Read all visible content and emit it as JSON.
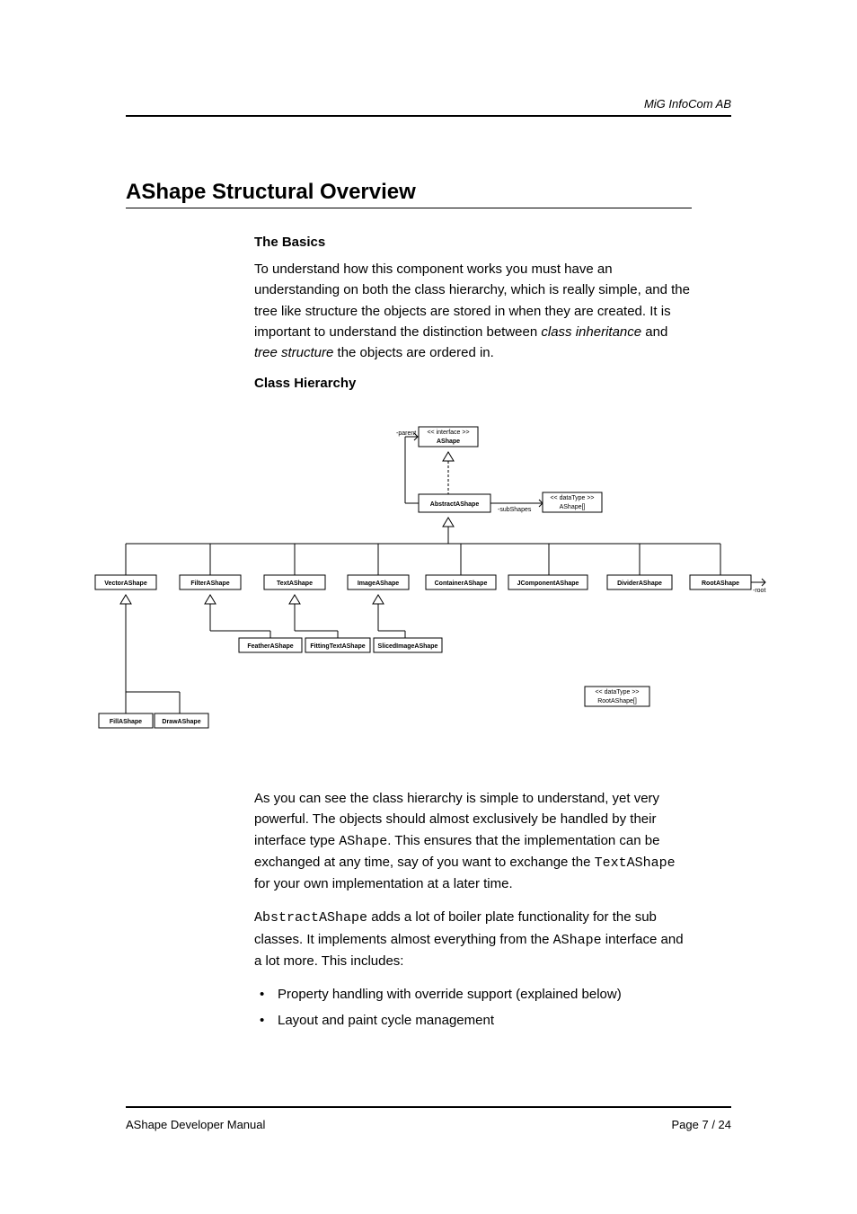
{
  "header": {
    "company": "MiG InfoCom AB"
  },
  "title": "AShape Structural Overview",
  "section1": {
    "heading": "The Basics",
    "p1_a": "To understand how this component works you must have an understanding on both the class hierarchy, which is really simple, and the tree like structure the objects are stored in when they are created. It is important to understand the distinction between ",
    "p1_i1": "class inheritance",
    "p1_b": " and ",
    "p1_i2": "tree structure",
    "p1_c": " the objects are ordered in."
  },
  "section2": {
    "heading": "Class Hierarchy"
  },
  "diagram": {
    "interface_stereo": "<< interface >>",
    "ashape": "AShape",
    "parent_lbl": "-parent",
    "abstract": "AbstractAShape",
    "subshapes_lbl": "-subShapes",
    "datatype_stereo": "<< dataType >>",
    "ashape_arr": "AShape[]",
    "leaves": {
      "vector": "VectorAShape",
      "filter": "FilterAShape",
      "text": "TextAShape",
      "image": "ImageAShape",
      "container": "ContainerAShape",
      "jcomponent": "JComponentAShape",
      "divider": "DividerAShape",
      "root": "RootAShape"
    },
    "sub2": {
      "feather": "FeatherAShape",
      "fittingtext": "FittingTextAShape",
      "slicedimage": "SlicedImageAShape",
      "fill": "FillAShape",
      "draw": "DrawAShape"
    },
    "rootarr_stereo": "<< dataType >>",
    "rootarr": "RootAShape[]",
    "root_lbl": "-root"
  },
  "section3": {
    "p1_a": "As you can see the class hierarchy is simple to understand, yet very powerful. The objects should almost exclusively be handled by their interface type ",
    "p1_m1": "AShape",
    "p1_b": ". This ensures that the implementation can be exchanged at any time, say of you want to exchange the ",
    "p1_m2": "TextAShape",
    "p1_c": " for your own implementation at a later time.",
    "p2_m1": "AbstractAShape",
    "p2_a": " adds a lot of boiler plate functionality for the sub classes. It implements almost everything from the ",
    "p2_m2": "AShape",
    "p2_b": " interface and a lot more. This includes:",
    "bullets": [
      "Property handling with override support (explained below)",
      "Layout and paint cycle management"
    ]
  },
  "footer": {
    "left": "AShape Developer Manual",
    "right": "Page 7 / 24"
  }
}
